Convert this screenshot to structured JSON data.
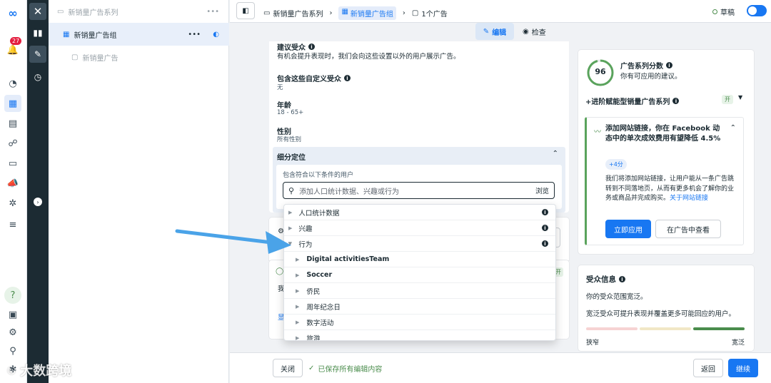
{
  "rail": {
    "badge": "27"
  },
  "tree": {
    "campaign": "新销量广告系列",
    "adset": "新销量广告组",
    "ad": "新销量广告"
  },
  "topbar": {
    "crumb_campaign": "新销量广告系列",
    "crumb_adset": "新销量广告组",
    "crumb_ad": "1个广告",
    "draft": "草稿",
    "edit": "编辑",
    "review": "检查"
  },
  "audience": {
    "suggest_title": "建议受众",
    "suggest_desc": "有机会提升表现时，我们会向这些设置以外的用户展示广告。",
    "custom_title": "包含这些自定义受众",
    "custom_value": "无",
    "age_title": "年龄",
    "age_value": "18 - 65+",
    "gender_title": "性别",
    "gender_value": "所有性别",
    "detailed_title": "细分定位",
    "include_label": "包含符合以下条件的用户",
    "search_placeholder": "添加人口统计数据、兴趣或行为",
    "browse": "浏览",
    "behind_l1": "我",
    "behind_l2": "显",
    "behind_tag": "开"
  },
  "dropdown": {
    "top_items": [
      "人口统计数据",
      "兴趣",
      "行为"
    ],
    "sub_items": [
      "Digital activitiesTeam",
      "Soccer",
      "侨民",
      "周年纪念日",
      "数字活动",
      "旅游"
    ]
  },
  "score": {
    "value": "96",
    "title": "广告系列分数",
    "subtitle": "你有可应用的建议。"
  },
  "advantage": {
    "title": "+进阶赋能型销量广告系列",
    "toggle": "开"
  },
  "recommendation": {
    "title": "添加网站链接，你在 Facebook 动态中的单次成效费用有望降低 4.5%",
    "points": "+4分",
    "body": "我们将添加网站链接，让用户能从一条广告跳转到不同落地页，从而有更多机会了解你的业务或商品并完成购买。",
    "link": "关于网站链接",
    "apply": "立即应用",
    "view": "在广告中查看"
  },
  "audience_info": {
    "title": "受众信息",
    "range": "你的受众范围宽泛。",
    "tip": "宽泛受众可提升表现并覆盖更多可能回应的用户。",
    "narrow": "狭窄",
    "broad": "宽泛"
  },
  "footer": {
    "close": "关闭",
    "saved": "已保存所有编辑内容",
    "back": "返回",
    "continue": "继续"
  },
  "watermark": "大数跨境",
  "colors": {
    "accent": "#1877f2",
    "dark_rail": "#1c2b33",
    "arrow": "#4aa3e8",
    "score_ring": "#5aa35c"
  }
}
